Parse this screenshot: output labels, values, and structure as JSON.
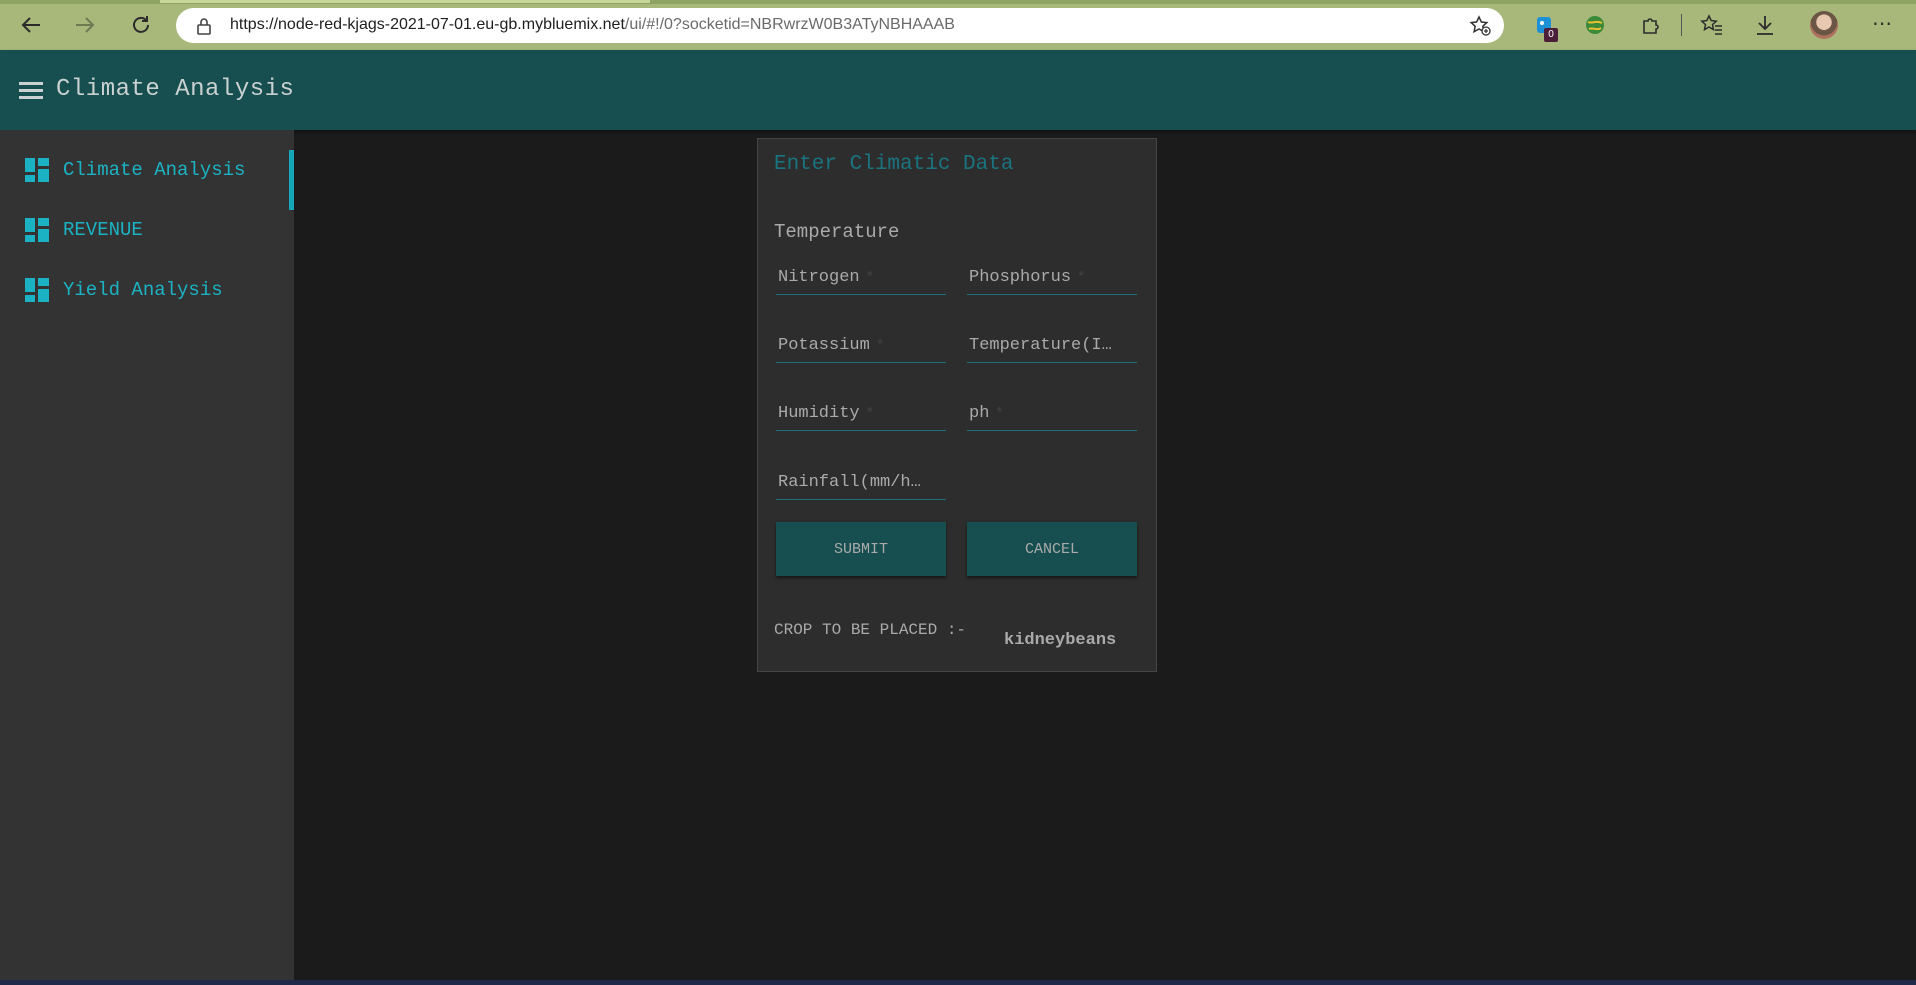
{
  "browser": {
    "url_main": "https://node-red-kjags-2021-07-01.eu-gb.mybluemix.net",
    "url_path": "/ui/#!/0?socketid=NBRwrzW0B3ATyNBHAAAB",
    "extension_badge": "0"
  },
  "header": {
    "title": "Climate Analysis"
  },
  "sidebar": {
    "items": [
      {
        "label": "Climate Analysis",
        "active": true
      },
      {
        "label": "REVENUE",
        "active": false
      },
      {
        "label": "Yield Analysis",
        "active": false
      }
    ]
  },
  "card": {
    "title": "Enter Climatic Data",
    "text": "Temperature",
    "fields": {
      "nitrogen": "Nitrogen",
      "phosphorus": "Phosphorus",
      "potassium": "Potassium",
      "temperature": "Temperature(I…",
      "humidity": "Humidity",
      "ph": "ph",
      "rainfall": "Rainfall(mm/h…"
    },
    "required_mark": "*",
    "submit_label": "SUBMIT",
    "cancel_label": "CANCEL",
    "result_label": "CROP TO BE PLACED :-",
    "result_value": "kidneybeans"
  },
  "colors": {
    "header_bg": "#174e4f",
    "accent": "#1bb3c4",
    "sidebar_bg": "#333333",
    "page_bg": "#1b1b1b"
  }
}
